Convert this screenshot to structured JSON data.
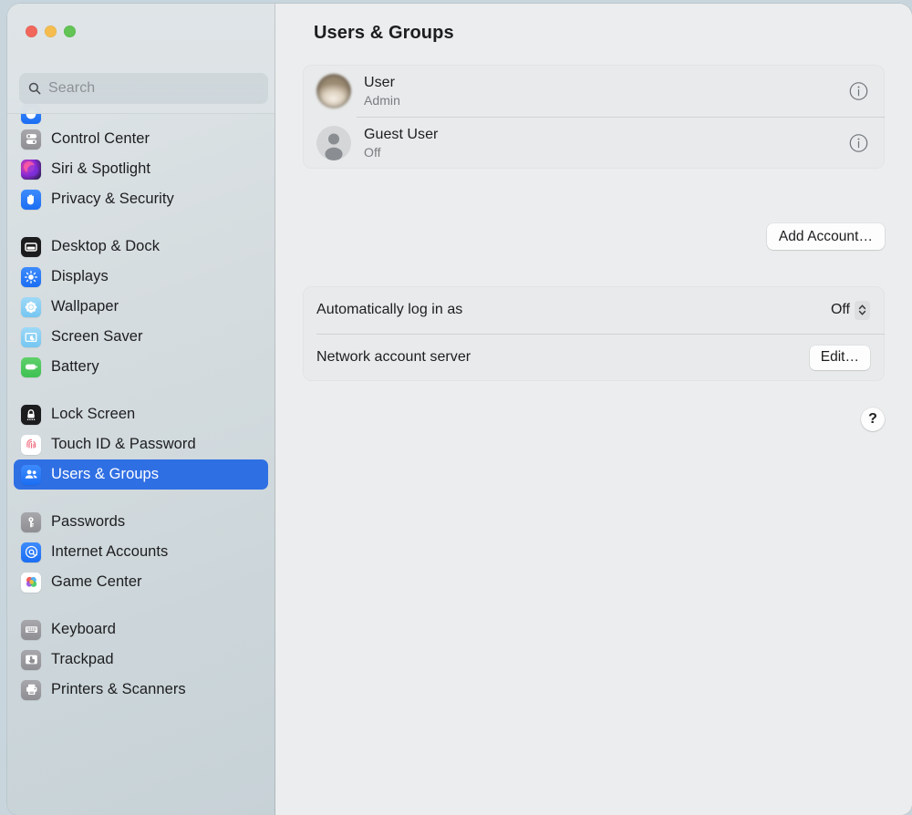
{
  "window": {
    "traffic_lights": [
      {
        "name": "close",
        "color": "#f1675c"
      },
      {
        "name": "minimize",
        "color": "#f5bd4f"
      },
      {
        "name": "zoom",
        "color": "#61c455"
      }
    ]
  },
  "sidebar": {
    "search": {
      "placeholder": "Search",
      "value": "",
      "icon": "search-icon"
    },
    "items": [
      {
        "label": "Control Center",
        "icon": "control-center-icon",
        "selected": false,
        "group": 0
      },
      {
        "label": "Siri & Spotlight",
        "icon": "siri-spotlight-icon",
        "selected": false,
        "group": 0
      },
      {
        "label": "Privacy & Security",
        "icon": "privacy-security-icon",
        "selected": false,
        "group": 0
      },
      {
        "label": "Desktop & Dock",
        "icon": "desktop-dock-icon",
        "selected": false,
        "group": 1
      },
      {
        "label": "Displays",
        "icon": "displays-icon",
        "selected": false,
        "group": 1
      },
      {
        "label": "Wallpaper",
        "icon": "wallpaper-icon",
        "selected": false,
        "group": 1
      },
      {
        "label": "Screen Saver",
        "icon": "screen-saver-icon",
        "selected": false,
        "group": 1
      },
      {
        "label": "Battery",
        "icon": "battery-icon",
        "selected": false,
        "group": 1
      },
      {
        "label": "Lock Screen",
        "icon": "lock-screen-icon",
        "selected": false,
        "group": 2
      },
      {
        "label": "Touch ID & Password",
        "icon": "touch-id-icon",
        "selected": false,
        "group": 2
      },
      {
        "label": "Users & Groups",
        "icon": "users-groups-icon",
        "selected": true,
        "group": 2
      },
      {
        "label": "Passwords",
        "icon": "passwords-icon",
        "selected": false,
        "group": 3
      },
      {
        "label": "Internet Accounts",
        "icon": "internet-accounts-icon",
        "selected": false,
        "group": 3
      },
      {
        "label": "Game Center",
        "icon": "game-center-icon",
        "selected": false,
        "group": 3
      },
      {
        "label": "Keyboard",
        "icon": "keyboard-icon",
        "selected": false,
        "group": 4
      },
      {
        "label": "Trackpad",
        "icon": "trackpad-icon",
        "selected": false,
        "group": 4
      },
      {
        "label": "Printers & Scanners",
        "icon": "printers-scanners-icon",
        "selected": false,
        "group": 4
      }
    ],
    "selection_color": "#2f6fe4"
  },
  "main": {
    "title": "Users & Groups",
    "accounts": [
      {
        "name": "User",
        "role": "Admin",
        "avatar": "user-photo-avatar",
        "info_icon": "info-icon"
      },
      {
        "name": "Guest User",
        "role": "Off",
        "avatar": "guest-silhouette-avatar",
        "info_icon": "info-icon"
      }
    ],
    "add_account_label": "Add Account…",
    "settings": [
      {
        "label": "Automatically log in as",
        "control": "popup",
        "value": "Off"
      },
      {
        "label": "Network account server",
        "control": "button",
        "value": "Edit…"
      }
    ],
    "help_label": "?"
  }
}
